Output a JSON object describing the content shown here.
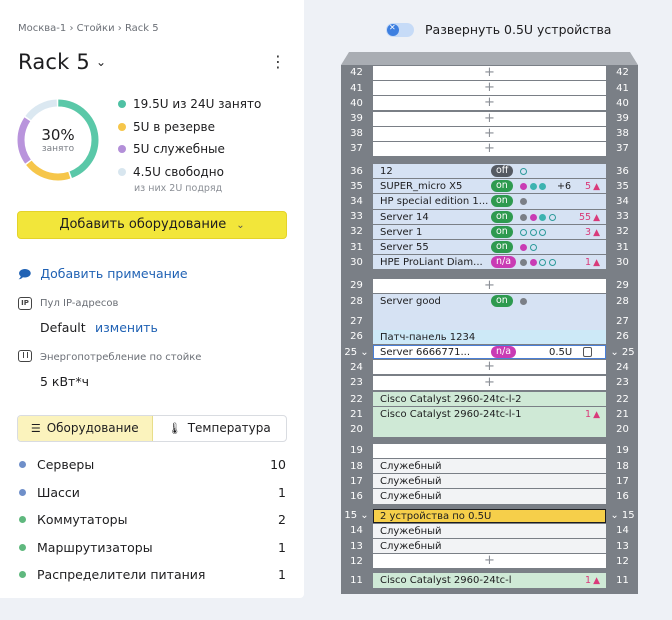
{
  "breadcrumb": "Москва-1 › Стойки › Rack 5",
  "rack_name": "Rack 5",
  "title_chevron": "⌄",
  "kebab": "⋮",
  "donut": {
    "percent": "30%",
    "label": "занято",
    "segments": [
      {
        "color": "#5ac8a8",
        "frac": 0.45
      },
      {
        "color": "#f6c64a",
        "frac": 0.2
      },
      {
        "color": "#b994dc",
        "frac": 0.2
      },
      {
        "color": "#dbe8f1",
        "frac": 0.15
      }
    ]
  },
  "legend": [
    {
      "text": "19.5U из 24U занято",
      "color": "#4fc1a4"
    },
    {
      "text": "5U в резерве",
      "color": "#f6c64a"
    },
    {
      "text": "5U служебные",
      "color": "#b38fd8"
    },
    {
      "text": "4.5U свободно",
      "color": "#d8e6ef"
    }
  ],
  "legend_note": "из них 2U подряд",
  "add_button": "Добавить оборудование",
  "add_chevron": "⌄",
  "note_link": "Добавить примечание",
  "ip": {
    "label": "Пул IP-адресов",
    "value": "Default",
    "change": "изменить",
    "icon_text": "IP"
  },
  "power": {
    "label": "Энергопотребление по стойке",
    "value": "5 кВт*ч"
  },
  "tabs": [
    {
      "label": "Оборудование"
    },
    {
      "label": "Температура"
    }
  ],
  "categories": [
    {
      "name": "Серверы",
      "count": "10",
      "color": "#6f8fc9"
    },
    {
      "name": "Шасси",
      "count": "1",
      "color": "#6f8fc9"
    },
    {
      "name": "Коммутаторы",
      "count": "2",
      "color": "#5fb87e"
    },
    {
      "name": "Маршрутизаторы",
      "count": "1",
      "color": "#5fb87e"
    },
    {
      "name": "Распределители питания",
      "count": "1",
      "color": "#5fb87e"
    }
  ],
  "toggle_label": "Развернуть 0.5U устройства",
  "rack_units": [
    "42",
    "41",
    "40",
    "39",
    "38",
    "37",
    "36",
    "35",
    "34",
    "33",
    "32",
    "31",
    "30",
    "29",
    "28",
    "27",
    "26",
    "25",
    "24",
    "23",
    "22",
    "21",
    "20",
    "19",
    "18",
    "17",
    "16",
    "15",
    "14",
    "13",
    "12",
    "11"
  ],
  "devices": {
    "d36": {
      "name": "12",
      "badge": "off"
    },
    "d35": {
      "name": "SUPER_micro X5",
      "badge": "on",
      "extra": "+6",
      "warn": "5"
    },
    "d34": {
      "name": "HP special edition 1...",
      "badge": "on"
    },
    "d33": {
      "name": "Server 14",
      "badge": "on",
      "warn": "55"
    },
    "d32": {
      "name": "Server 1",
      "badge": "on",
      "warn": "3"
    },
    "d31": {
      "name": "Server 55",
      "badge": "on"
    },
    "d30": {
      "name": "HPE ProLiant Diam...",
      "badge": "n/a",
      "warn": "1"
    },
    "d29": {
      "name": "Server good",
      "badge": "on"
    },
    "d26": {
      "name": "Патч-панель 1234"
    },
    "d25": {
      "name": "Server 6666771...",
      "badge": "n/a",
      "cap": "0.5U"
    },
    "d22": {
      "name": "Cisco Catalyst 2960-24tc-l-2"
    },
    "d21": {
      "name": "Cisco Catalyst 2960-24tc-l-1",
      "warn": "1"
    },
    "d18": {
      "name": "Служебный"
    },
    "d17": {
      "name": "Служебный"
    },
    "d16": {
      "name": "Служебный"
    },
    "d15": {
      "name": "2 устройства по 0.5U"
    },
    "d14": {
      "name": "Служебный"
    },
    "d13": {
      "name": "Служебный"
    },
    "d11": {
      "name": "Cisco Catalyst 2960-24tc-l",
      "warn": "1"
    }
  },
  "plus": "+",
  "warn_icon": "▲"
}
